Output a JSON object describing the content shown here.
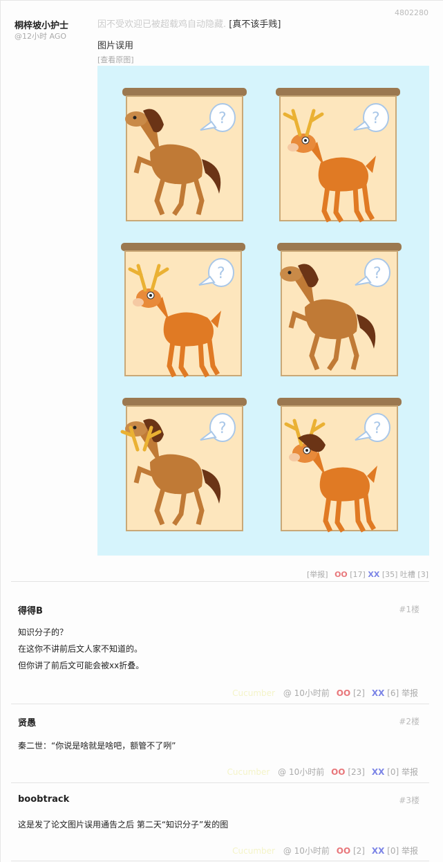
{
  "post": {
    "id": "4802280",
    "author": "桐梓坡小护士",
    "time": "@12小时 AGO",
    "hidden_note": "因不受欢迎已被超载鸡自动隐藏.",
    "hidden_tag": "[真不该手贱]",
    "title": "图片误用",
    "view_original": "[查看原图]",
    "report": "[举报]",
    "oo_label": "OO",
    "oo_count": "[17]",
    "xx_label": "XX",
    "xx_count": "[35]",
    "tucao": "吐槽 [3]"
  },
  "comments": [
    {
      "name": "得得B",
      "floor": "#1楼",
      "lines": [
        "知识分子的？",
        "在这你不讲前后文人家不知道的。",
        "但你讲了前后文可能会被xx折叠。"
      ],
      "ghost": "Cucumber",
      "at": "@",
      "time": "10小时前",
      "oo_label": "OO",
      "oo_count": "[2]",
      "xx_label": "XX",
      "xx_count": "[6]",
      "report": "举报"
    },
    {
      "name": "贤愚",
      "floor": "#2楼",
      "lines": [
        "秦二世：“你说是啥就是啥吧，额管不了咧”"
      ],
      "ghost": "Cucumber",
      "at": "@",
      "time": "10小时前",
      "oo_label": "OO",
      "oo_count": "[23]",
      "xx_label": "XX",
      "xx_count": "[0]",
      "report": "举报"
    },
    {
      "name": "boobtrack",
      "floor": "#3楼",
      "lines": [
        "这是发了论文图片误用通告之后 第二天“知识分子”发的图"
      ],
      "ghost": "Cucumber",
      "at": "@",
      "time": "10小时前",
      "oo_label": "OO",
      "oo_count": "[2]",
      "xx_label": "XX",
      "xx_count": "[0]",
      "report": "举报"
    }
  ],
  "image": {
    "panels": [
      "horse",
      "deer",
      "deer",
      "horse",
      "deer-horse",
      "horse-deer"
    ]
  },
  "colors": {
    "accent_oo": "#e8777b",
    "accent_xx": "#7b84e6",
    "image_bg": "#d6f4fc",
    "frame_bg": "#fde6bd",
    "rod": "#9b7850"
  }
}
